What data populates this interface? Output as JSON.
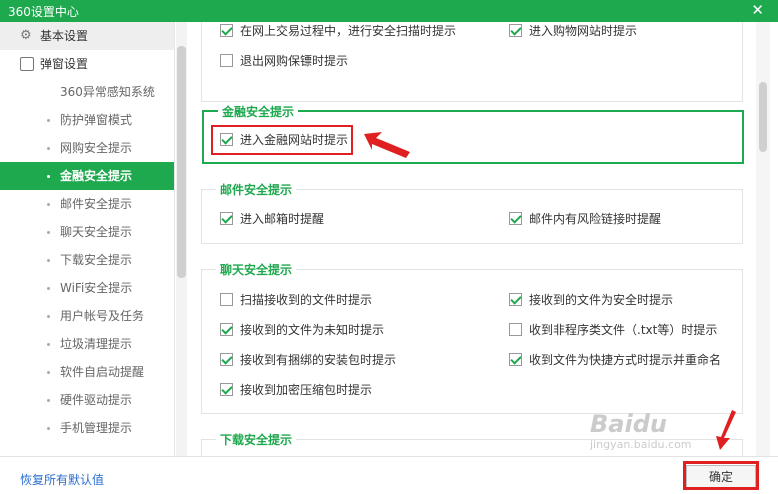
{
  "window": {
    "title": "360设置中心",
    "close_glyph": "✕"
  },
  "sidebar": {
    "groups": [
      {
        "label": "基本设置",
        "icon": "gear-icon"
      },
      {
        "label": "弹窗设置",
        "icon": "window-icon"
      }
    ],
    "items": [
      {
        "label": "360异常感知系统"
      },
      {
        "label": "防护弹窗模式"
      },
      {
        "label": "网购安全提示"
      },
      {
        "label": "金融安全提示",
        "active": true
      },
      {
        "label": "邮件安全提示"
      },
      {
        "label": "聊天安全提示"
      },
      {
        "label": "下载安全提示"
      },
      {
        "label": "WiFi安全提示"
      },
      {
        "label": "用户帐号及任务"
      },
      {
        "label": "垃圾清理提示"
      },
      {
        "label": "软件自启动提醒"
      },
      {
        "label": "硬件驱动提示"
      },
      {
        "label": "手机管理提示"
      }
    ]
  },
  "sections": {
    "shopping": {
      "options": [
        {
          "label": "在网上交易过程中，进行安全扫描时提示",
          "checked": true
        },
        {
          "label": "进入购物网站时提示",
          "checked": true
        },
        {
          "label": "退出网购保镖时提示",
          "checked": false
        }
      ]
    },
    "finance": {
      "title": "金融安全提示",
      "options": [
        {
          "label": "进入金融网站时提示",
          "checked": true
        }
      ]
    },
    "mail": {
      "title": "邮件安全提示",
      "options": [
        {
          "label": "进入邮箱时提醒",
          "checked": true
        },
        {
          "label": "邮件内有风险链接时提醒",
          "checked": true
        }
      ]
    },
    "chat": {
      "title": "聊天安全提示",
      "options": [
        {
          "label": "扫描接收到的文件时提示",
          "checked": false
        },
        {
          "label": "接收到的文件为安全时提示",
          "checked": true
        },
        {
          "label": "接收到的文件为未知时提示",
          "checked": true
        },
        {
          "label": "收到非程序类文件（.txt等）时提示",
          "checked": false
        },
        {
          "label": "接收到有捆绑的安装包时提示",
          "checked": true
        },
        {
          "label": "收到文件为快捷方式时提示并重命名",
          "checked": true
        },
        {
          "label": "接收到加密压缩包时提示",
          "checked": true
        }
      ]
    },
    "download": {
      "title": "下载安全提示"
    }
  },
  "footer": {
    "reset_label": "恢复所有默认值",
    "ok_label": "确定"
  },
  "watermark": {
    "brand": "Baidu",
    "url": "jingyan.baidu.com"
  },
  "colors": {
    "accent": "#1fa94f",
    "annotation": "#e02020",
    "link": "#2a6ecf"
  }
}
